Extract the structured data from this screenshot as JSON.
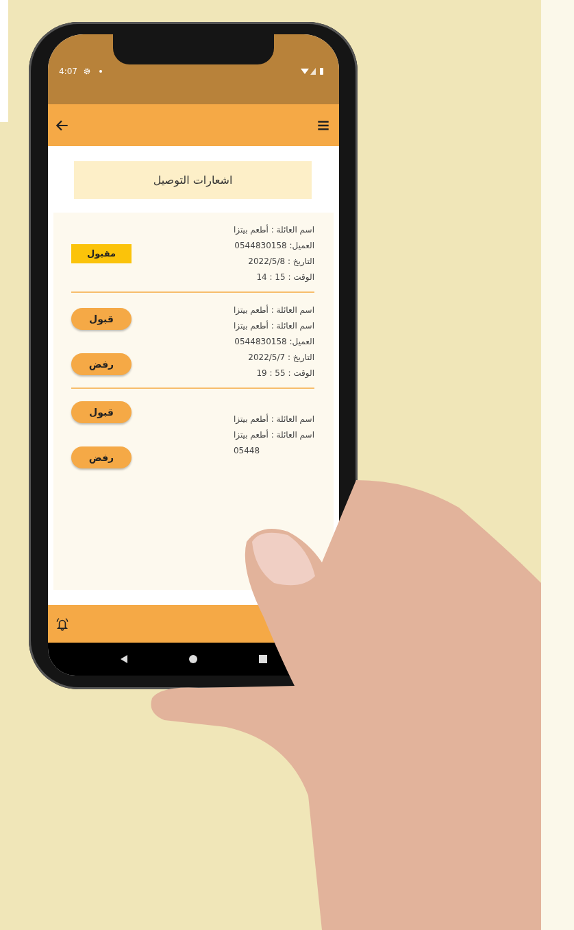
{
  "status_bar": {
    "time": "4:07"
  },
  "title": "اشعارات التوصيل",
  "notifications": [
    {
      "kind": "accepted",
      "badge": "مقبول",
      "lines": [
        {
          "text": "اسم العائلة : أطعم بيتزا",
          "kind": "full"
        },
        {
          "text": "العميل: 0544830158",
          "kind": "full"
        },
        {
          "text": "التاريخ : 2022/5/8",
          "kind": "full"
        },
        {
          "text": "الوقت : 15 : 14",
          "kind": "full"
        }
      ]
    },
    {
      "kind": "pending",
      "actions": [
        "قبول",
        "رفض"
      ],
      "lines": [
        {
          "text": "اسم العائلة : أطعم بيتزا",
          "kind": "full"
        },
        {
          "text": "اسم العائلة : أطعم بيتزا",
          "kind": "full"
        },
        {
          "text": "العميل: 0544830158",
          "kind": "full"
        },
        {
          "text": "التاريخ : 2022/5/7",
          "kind": "full"
        },
        {
          "text": "الوقت : 55 : 19",
          "kind": "full"
        }
      ]
    },
    {
      "kind": "pending",
      "actions": [
        "قبول",
        "رفض"
      ],
      "lines": [
        {
          "text": "اسم العائلة : أطعم بيتزا",
          "kind": "full"
        },
        {
          "text": "اسم العائلة : أطعم بيتزا",
          "kind": "full"
        },
        {
          "text": "05448",
          "kind": "partial"
        }
      ]
    }
  ]
}
